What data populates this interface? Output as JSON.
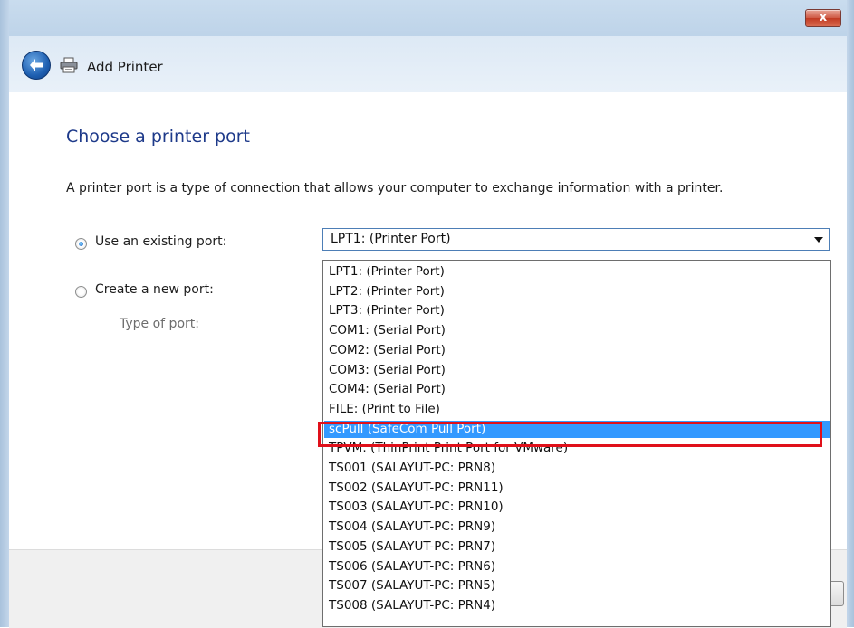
{
  "window": {
    "title": "Add Printer",
    "close_label": "x"
  },
  "page": {
    "heading": "Choose a printer port",
    "description": "A printer port is a type of connection that allows your computer to exchange information with a printer."
  },
  "options": {
    "existing_port_label": "Use an existing port:",
    "new_port_label": "Create a new port:",
    "type_of_port_label": "Type of port:",
    "existing_port_checked": true
  },
  "port_select": {
    "selected_value": "LPT1: (Printer Port)",
    "items": [
      "LPT1: (Printer Port)",
      "LPT2: (Printer Port)",
      "LPT3: (Printer Port)",
      "COM1: (Serial Port)",
      "COM2: (Serial Port)",
      "COM3: (Serial Port)",
      "COM4: (Serial Port)",
      "FILE: (Print to File)",
      "scPull (SafeCom Pull Port)",
      "TPVM: (ThinPrint Print Port for VMware)",
      "TS001 (SALAYUT-PC:  PRN8)",
      "TS002 (SALAYUT-PC:  PRN11)",
      "TS003 (SALAYUT-PC:  PRN10)",
      "TS004 (SALAYUT-PC:  PRN9)",
      "TS005 (SALAYUT-PC:  PRN7)",
      "TS006 (SALAYUT-PC:  PRN6)",
      "TS007 (SALAYUT-PC:  PRN5)",
      "TS008 (SALAYUT-PC:  PRN4)"
    ],
    "highlighted_item": "scPull (SafeCom Pull Port)"
  },
  "colors": {
    "heading": "#1e3a8a",
    "selection": "#3399ff",
    "annotation_box": "#e0101a"
  }
}
